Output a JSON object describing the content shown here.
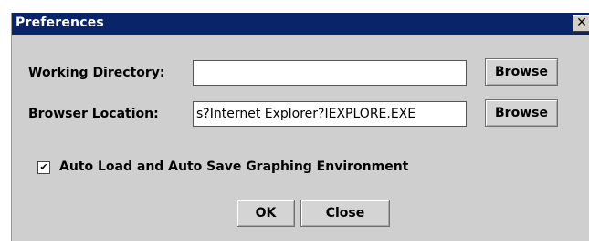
{
  "window": {
    "title": "Preferences",
    "close_glyph": "✕"
  },
  "working_directory": {
    "label": "Working Directory:",
    "value": "",
    "browse_label": "Browse"
  },
  "browser_location": {
    "label": "Browser Location:",
    "value": "s?Internet Explorer?IEXPLORE.EXE",
    "browse_label": "Browse"
  },
  "auto_save": {
    "label": "Auto Load and Auto Save Graphing Environment",
    "checked": true
  },
  "buttons": {
    "ok_label": "OK",
    "close_label": "Close"
  },
  "colors": {
    "titlebar": "#0a246a",
    "dialog_background": "#cfcfcf"
  },
  "icons": {
    "close": "close-icon",
    "check": "checkmark-icon"
  }
}
